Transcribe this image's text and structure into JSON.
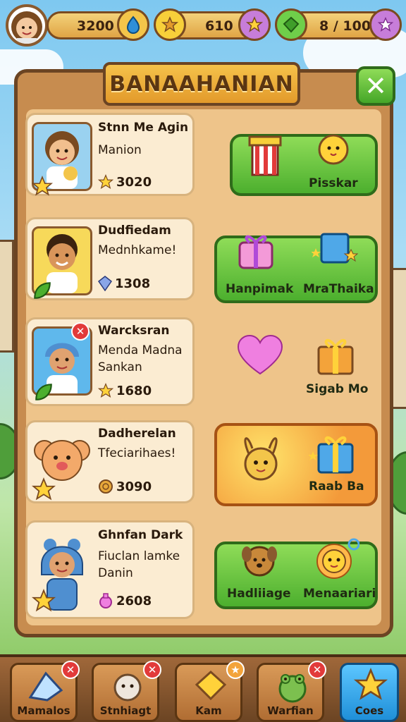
{
  "colors": {
    "panel_wood": "#c78c4f",
    "panel_inner": "#eec48a",
    "green_button": "#4caf2e",
    "orange_button": "#f39a3a",
    "nav_active": "#1f8fd8",
    "badge_red": "#e23a3a"
  },
  "topbar": {
    "coins": {
      "value": "3200",
      "icon": "drop-pin-icon"
    },
    "stars": {
      "value": "610",
      "icon": "star-icon"
    },
    "gems": {
      "value": "8 / 100",
      "icon": "gem-icon"
    }
  },
  "panel": {
    "title": "BANAAHANIAN",
    "close_icon": "close-icon"
  },
  "rows": [
    {
      "name": "Stnn Me Agin",
      "subtitle": "Manion",
      "amount": "3020",
      "amount_icon": "star-icon",
      "action": {
        "style": "green",
        "labels": [
          "Pisskar"
        ]
      }
    },
    {
      "name": "Dudfiedam",
      "subtitle": "Mednhkame!",
      "amount": "1308",
      "amount_icon": "gem-icon",
      "action": {
        "style": "green",
        "labels": [
          "Hanpimak",
          "MraThaika"
        ]
      }
    },
    {
      "name": "Warcksran",
      "subtitle": "Menda Madna",
      "subtitle2": "Sankan",
      "amount": "1680",
      "amount_icon": "star-icon",
      "action": {
        "style": "none",
        "labels": [
          "Sigab Mo"
        ]
      }
    },
    {
      "name": "Dadherelan",
      "subtitle": "Tfeciarihaes!",
      "amount": "3090",
      "amount_icon": "coin-icon",
      "action": {
        "style": "orange",
        "labels": [
          "Raab Ba"
        ]
      }
    },
    {
      "name": "Ghnfan Dark",
      "subtitle": "Fiuclan lamke",
      "subtitle2": "Danin",
      "amount": "2608",
      "amount_icon": "potion-icon",
      "action": {
        "style": "green",
        "labels": [
          "Hadliiage",
          "Menaariari"
        ]
      }
    }
  ],
  "nav": [
    {
      "label": "Mamalos",
      "icon": "crystal-icon",
      "badge": "✕"
    },
    {
      "label": "Stnhiagt",
      "icon": "sheep-icon",
      "badge": "✕"
    },
    {
      "label": "Kam",
      "icon": "gold-block-icon",
      "badge": "★"
    },
    {
      "label": "Warfian",
      "icon": "frog-icon",
      "badge": "✕"
    },
    {
      "label": "Coes",
      "icon": "star-icon",
      "badge": ""
    }
  ]
}
